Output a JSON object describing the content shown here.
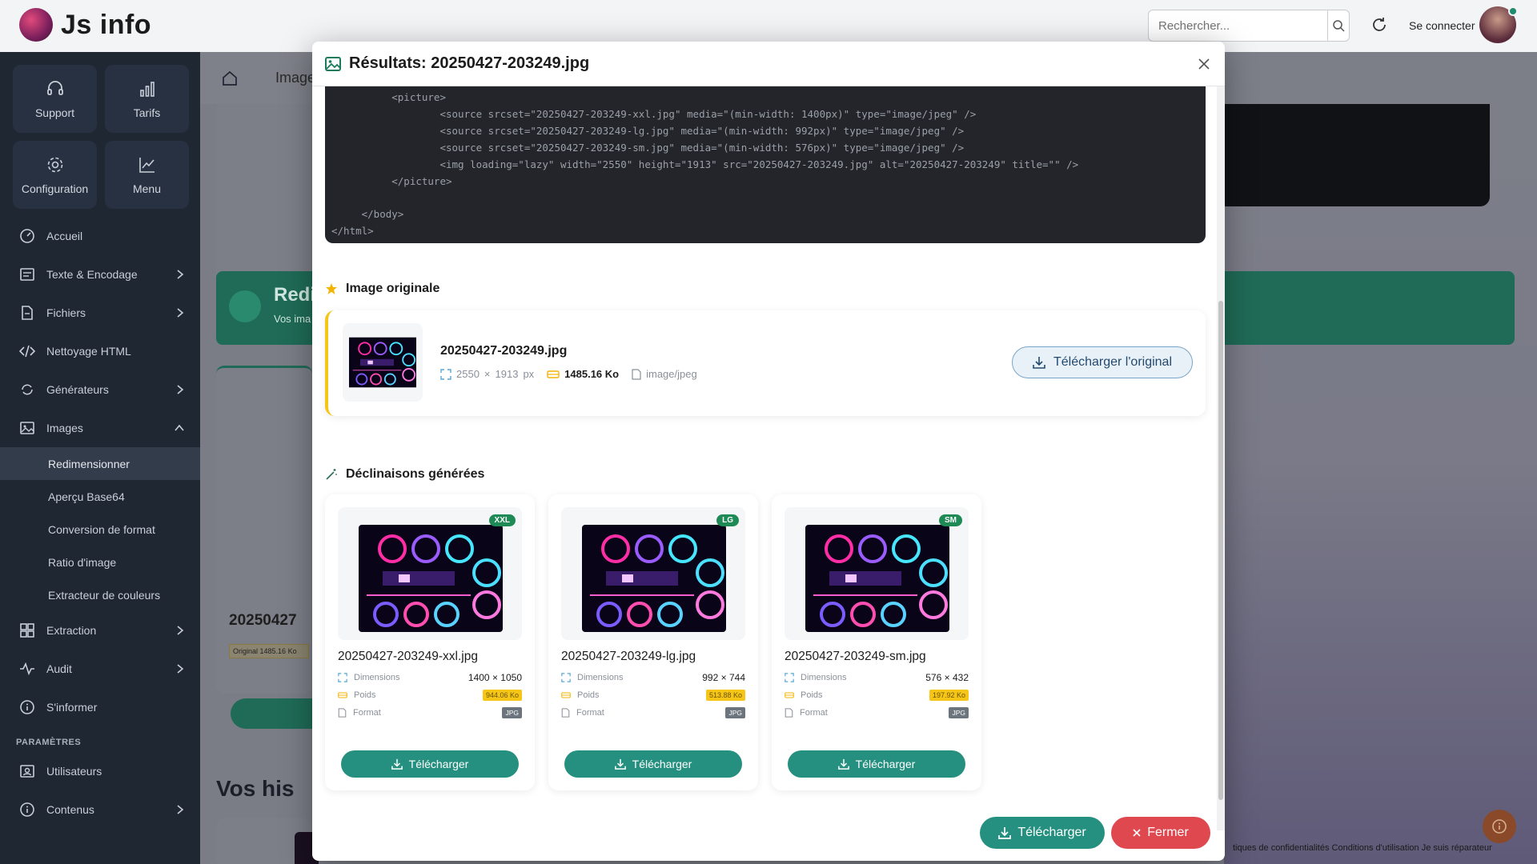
{
  "app": {
    "name": "Js info"
  },
  "header": {
    "search_placeholder": "Rechercher...",
    "login_label": "Se connecter"
  },
  "sidebar": {
    "quick": [
      {
        "label": "Support",
        "icon": "headset-icon"
      },
      {
        "label": "Tarifs",
        "icon": "bar-chart-icon"
      },
      {
        "label": "Configuration",
        "icon": "gear-icon"
      },
      {
        "label": "Menu",
        "icon": "trend-icon"
      }
    ],
    "items": [
      {
        "label": "Accueil",
        "icon": "dashboard-icon"
      },
      {
        "label": "Texte & Encodage",
        "icon": "text-icon",
        "has_children": true
      },
      {
        "label": "Fichiers",
        "icon": "file-icon",
        "has_children": true
      },
      {
        "label": "Nettoyage HTML",
        "icon": "code-icon"
      },
      {
        "label": "Générateurs",
        "icon": "sync-icon",
        "has_children": true
      },
      {
        "label": "Images",
        "icon": "image-icon",
        "expanded": true
      }
    ],
    "sub_items": [
      {
        "label": "Redimensionner",
        "active": true
      },
      {
        "label": "Aperçu Base64"
      },
      {
        "label": "Conversion de format"
      },
      {
        "label": "Ratio d'image"
      },
      {
        "label": "Extracteur de couleurs"
      }
    ],
    "items_after": [
      {
        "label": "Extraction",
        "icon": "grid-icon",
        "has_children": true
      },
      {
        "label": "Audit",
        "icon": "pulse-icon",
        "has_children": true
      },
      {
        "label": "S'informer",
        "icon": "info-icon"
      }
    ],
    "section_label": "PARAMÈTRES",
    "settings_items": [
      {
        "label": "Utilisateurs",
        "icon": "user-card-icon"
      },
      {
        "label": "Contenus",
        "icon": "info-icon",
        "has_children": true
      }
    ]
  },
  "background": {
    "breadcrumb": "Image",
    "green_title": "Redi",
    "green_sub": "Vos ima",
    "file_title": "20250427",
    "orig_tag": "Original",
    "orig_size": "1485.16 Ko",
    "history_title": "Vos his",
    "footer_links": "tiques de confidentialités   Conditions d'utilisation   Je suis réparateur"
  },
  "modal": {
    "title": "Résultats: 20250427-203249.jpg",
    "code_lines": [
      "          <picture>",
      "                  <source srcset=\"20250427-203249-xxl.jpg\" media=\"(min-width: 1400px)\" type=\"image/jpeg\" />",
      "                  <source srcset=\"20250427-203249-lg.jpg\" media=\"(min-width: 992px)\" type=\"image/jpeg\" />",
      "                  <source srcset=\"20250427-203249-sm.jpg\" media=\"(min-width: 576px)\" type=\"image/jpeg\" />",
      "                  <img loading=\"lazy\" width=\"2550\" height=\"1913\" src=\"20250427-203249.jpg\" alt=\"20250427-203249\" title=\"\" />",
      "          </picture>",
      "",
      "     </body>",
      "</html>"
    ],
    "original": {
      "section_title": "Image originale",
      "filename": "20250427-203249.jpg",
      "width": "2550",
      "times": "×",
      "height": "1913",
      "unit": "px",
      "size": "1485.16 Ko",
      "mime": "image/jpeg",
      "download_label": "Télécharger l'original"
    },
    "variants_title": "Déclinaisons générées",
    "variants": [
      {
        "badge": "XXL",
        "filename": "20250427-203249-xxl.jpg",
        "dim_label": "Dimensions",
        "width": "1400",
        "height": "1050",
        "weight_label": "Poids",
        "weight": "944.06 Ko",
        "format_label": "Format",
        "format": "JPG",
        "button": "Télécharger"
      },
      {
        "badge": "LG",
        "filename": "20250427-203249-lg.jpg",
        "dim_label": "Dimensions",
        "width": "992",
        "height": "744",
        "weight_label": "Poids",
        "weight": "513.88 Ko",
        "format_label": "Format",
        "format": "JPG",
        "button": "Télécharger"
      },
      {
        "badge": "SM",
        "filename": "20250427-203249-sm.jpg",
        "dim_label": "Dimensions",
        "width": "576",
        "height": "432",
        "weight_label": "Poids",
        "weight": "197.92 Ko",
        "format_label": "Format",
        "format": "JPG",
        "button": "Télécharger"
      }
    ],
    "footer": {
      "download_label": "Télécharger",
      "close_label": "Fermer"
    }
  },
  "colors": {
    "accent_green": "#25907f",
    "danger": "#e0484f",
    "warning": "#f5c518",
    "sidebar_bg": "#1f2733"
  }
}
